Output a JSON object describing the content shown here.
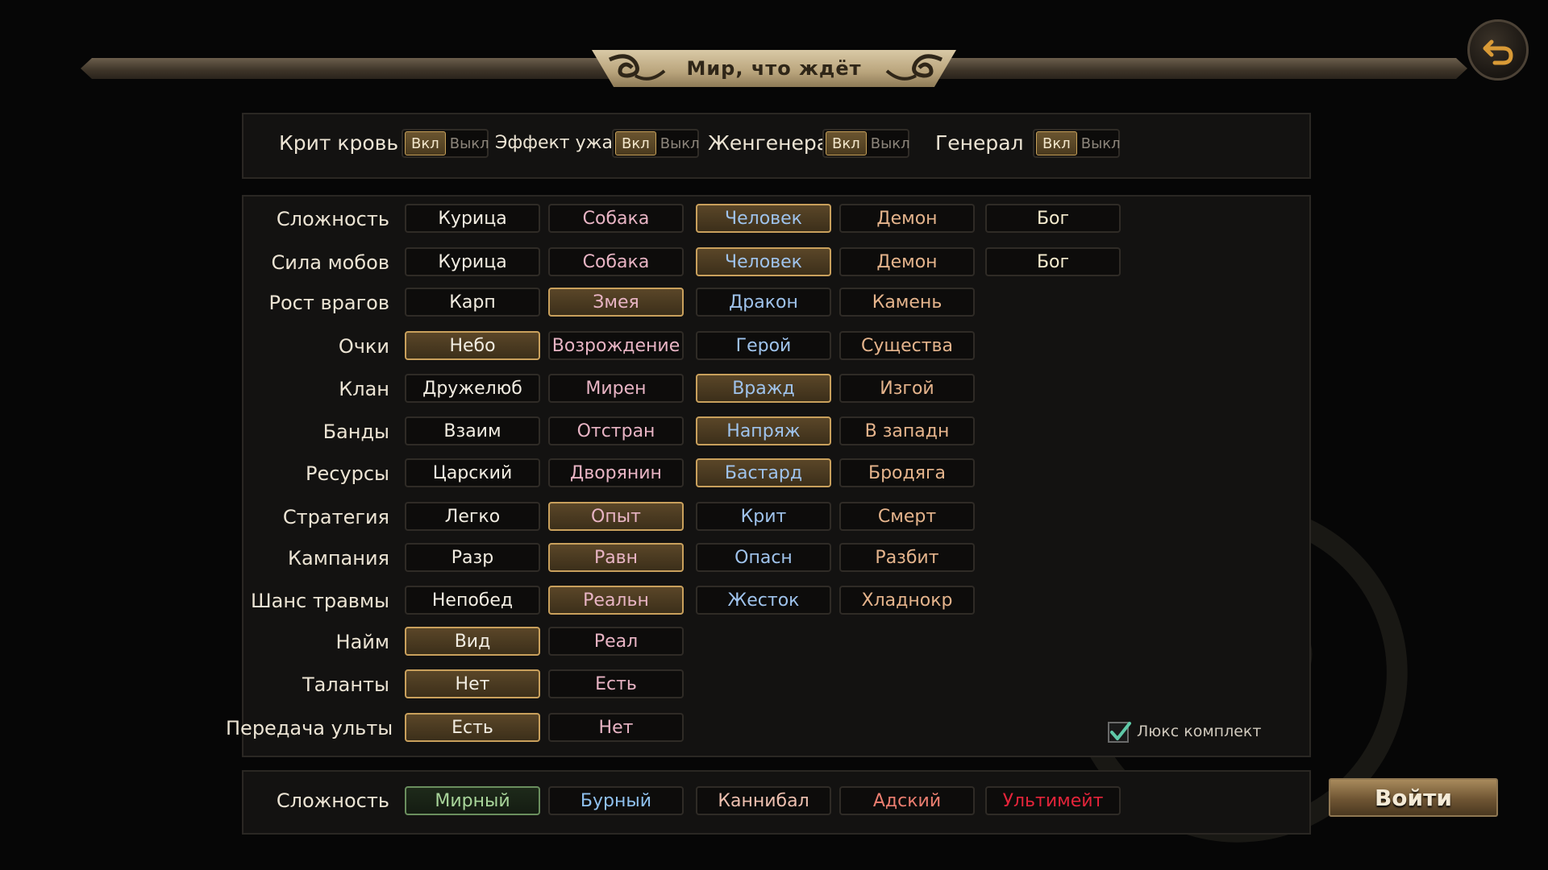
{
  "title": "Мир, что ждёт",
  "toggles": [
    {
      "label": "Крит кровь",
      "on": "Вкл",
      "off": "Выкл"
    },
    {
      "label": "Эффект ужаса",
      "on": "Вкл",
      "off": "Выкл"
    },
    {
      "label": "Женгенерал",
      "on": "Вкл",
      "off": "Выкл"
    },
    {
      "label": "Генерал",
      "on": "Вкл",
      "off": "Выкл"
    }
  ],
  "settings": [
    {
      "label": "Сложность",
      "options": [
        "Курица",
        "Собака",
        "Человек",
        "Демон",
        "Бог"
      ],
      "selected": 2
    },
    {
      "label": "Сила мобов",
      "options": [
        "Курица",
        "Собака",
        "Человек",
        "Демон",
        "Бог"
      ],
      "selected": 2
    },
    {
      "label": "Рост врагов",
      "options": [
        "Карп",
        "Змея",
        "Дракон",
        "Камень"
      ],
      "selected": 1
    },
    {
      "label": "Очки",
      "options": [
        "Небо",
        "Возрождение",
        "Герой",
        "Существа"
      ],
      "selected": 0
    },
    {
      "label": "Клан",
      "options": [
        "Дружелюб",
        "Мирен",
        "Вражд",
        "Изгой"
      ],
      "selected": 2
    },
    {
      "label": "Банды",
      "options": [
        "Взаим",
        "Отстран",
        "Напряж",
        "В западн"
      ],
      "selected": 2
    },
    {
      "label": "Ресурсы",
      "options": [
        "Царский",
        "Дворянин",
        "Бастард",
        "Бродяга"
      ],
      "selected": 2
    },
    {
      "label": "Стратегия",
      "options": [
        "Легко",
        "Опыт",
        "Крит",
        "Смерт"
      ],
      "selected": 1
    },
    {
      "label": "Кампания",
      "options": [
        "Разр",
        "Равн",
        "Опасн",
        "Разбит"
      ],
      "selected": 1
    },
    {
      "label": "Шанс травмы",
      "options": [
        "Непобед",
        "Реальн",
        "Жесток",
        "Хладнокр"
      ],
      "selected": 1
    },
    {
      "label": "Найм",
      "options": [
        "Вид",
        "Реал"
      ],
      "selected": 0
    },
    {
      "label": "Таланты",
      "options": [
        "Нет",
        "Есть"
      ],
      "selected": 0
    },
    {
      "label": "Передача ульты",
      "options": [
        "Есть",
        "Нет"
      ],
      "selected": 0
    }
  ],
  "deluxe": {
    "label": "Люкс комплект",
    "checked": true
  },
  "final_difficulty": {
    "label": "Сложность",
    "options": [
      "Мирный",
      "Бурный",
      "Каннибал",
      "Адский",
      "Ультимейт"
    ],
    "selected": 0
  },
  "enter_label": "Войти",
  "colors": {
    "accent_gold": "#c9a05c",
    "panel_bg": "#131211",
    "option_colors": [
      "#f2ede2",
      "#e8b4c4",
      "#9fc3ec",
      "#e5b48c",
      "#f6eccf"
    ],
    "difficulty_colors": [
      "#a8d59a",
      "#8fc0ee",
      "#eec0b0",
      "#ec7e70",
      "#e4243a"
    ]
  },
  "icons": {
    "back": "undo-arrow-icon",
    "check": "checkmark-icon"
  }
}
